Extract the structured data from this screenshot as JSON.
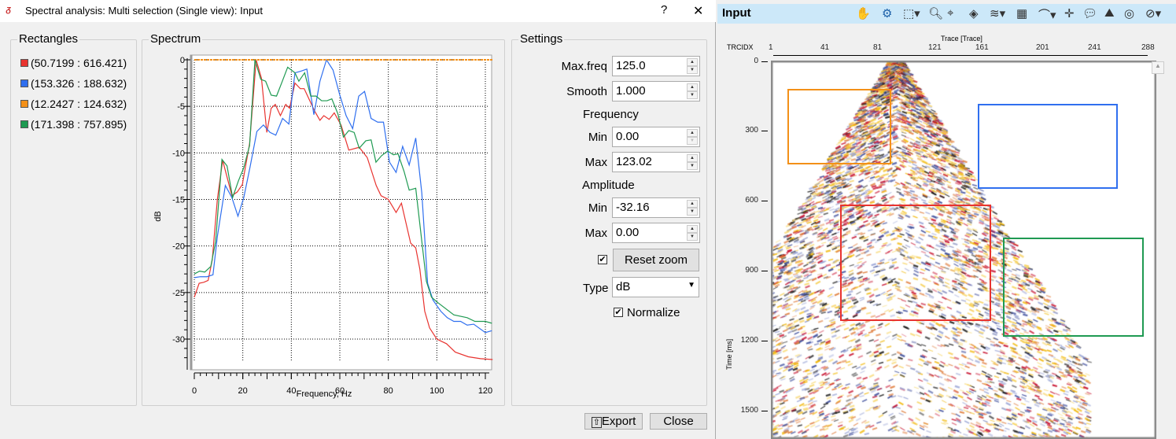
{
  "dialog": {
    "title": "Spectral analysis: Multi selection (Single view): Input",
    "help": "?",
    "close": "✕",
    "export_label": "Export",
    "close_label": "Close"
  },
  "rectangles": {
    "label": "Rectangles",
    "items": [
      {
        "text": "(50.7199 : 616.421)",
        "color": "#e8332f"
      },
      {
        "text": "(153.326 : 188.632)",
        "color": "#2f6fef"
      },
      {
        "text": "(12.2427 : 124.632)",
        "color": "#f39018"
      },
      {
        "text": "(171.398 : 757.895)",
        "color": "#1f9a52"
      }
    ]
  },
  "spectrum": {
    "label": "Spectrum"
  },
  "settings": {
    "label": "Settings",
    "max_freq_label": "Max.freq",
    "max_freq": "125.0",
    "smooth_label": "Smooth",
    "smooth": "1.000",
    "frequency_label": "Frequency",
    "freq_min_label": "Min",
    "freq_min": "0.00",
    "freq_max_label": "Max",
    "freq_max": "123.02",
    "amplitude_label": "Amplitude",
    "amp_min_label": "Min",
    "amp_min": "-32.16",
    "amp_max_label": "Max",
    "amp_max": "0.00",
    "reset_zoom_label": "Reset zoom",
    "reset_zoom_checked": true,
    "type_label": "Type",
    "type": "dB",
    "normalize_label": "Normalize",
    "normalize_checked": true
  },
  "chart_data": {
    "type": "line",
    "xlabel": "Frequency, Hz",
    "ylabel": "dB",
    "xlim": [
      0,
      123.02
    ],
    "ylim": [
      -32.16,
      0
    ],
    "xticks": [
      0,
      20,
      40,
      60,
      80,
      100,
      120
    ],
    "yticks": [
      0,
      -5,
      -10,
      -15,
      -20,
      -25,
      -30
    ],
    "grid": true,
    "series": [
      {
        "name": "(50.7199 : 616.421)",
        "color": "#e8332f",
        "points": [
          [
            0,
            -25.5
          ],
          [
            2,
            -24
          ],
          [
            3.9,
            -23.9
          ],
          [
            5.7,
            -23.7
          ],
          [
            7.4,
            -21.5
          ],
          [
            9.5,
            -15
          ],
          [
            11.7,
            -10.8
          ],
          [
            13.9,
            -13
          ],
          [
            15.5,
            -14.6
          ],
          [
            17.7,
            -14.2
          ],
          [
            19.8,
            -13.4
          ],
          [
            22.8,
            -9
          ],
          [
            25.5,
            0
          ],
          [
            27.7,
            -2
          ],
          [
            29.9,
            -7.8
          ],
          [
            31.7,
            -5.2
          ],
          [
            33.4,
            -4.8
          ],
          [
            35.5,
            -6
          ],
          [
            37.7,
            -4.8
          ],
          [
            39.3,
            -5.2
          ],
          [
            41.5,
            -2.5
          ],
          [
            43.7,
            -3.1
          ],
          [
            45.3,
            -3.1
          ],
          [
            49.6,
            -5.5
          ],
          [
            51.8,
            -6.5
          ],
          [
            53.4,
            -6
          ],
          [
            55.6,
            -6.4
          ],
          [
            57.7,
            -5.7
          ],
          [
            60.5,
            -7
          ],
          [
            63.7,
            -9.7
          ],
          [
            68,
            -9.4
          ],
          [
            71.3,
            -10.5
          ],
          [
            75,
            -13.5
          ],
          [
            77,
            -14.6
          ],
          [
            80,
            -15
          ],
          [
            83.2,
            -16.4
          ],
          [
            85.4,
            -15.4
          ],
          [
            89.2,
            -19.7
          ],
          [
            91.3,
            -20.2
          ],
          [
            93,
            -22.5
          ],
          [
            95,
            -27
          ],
          [
            97,
            -28.8
          ],
          [
            100,
            -30
          ],
          [
            104,
            -30.5
          ],
          [
            107.6,
            -31.4
          ],
          [
            113,
            -31.9
          ],
          [
            118,
            -32.1
          ],
          [
            123,
            -32.2
          ]
        ]
      },
      {
        "name": "(153.326 : 188.632)",
        "color": "#2f6fef",
        "points": [
          [
            0,
            -23.4
          ],
          [
            2.5,
            -23.3
          ],
          [
            5.2,
            -23.3
          ],
          [
            7.7,
            -23.1
          ],
          [
            9.5,
            -19
          ],
          [
            12.8,
            -13.5
          ],
          [
            15.5,
            -14.8
          ],
          [
            18,
            -16.8
          ],
          [
            20.4,
            -14.8
          ],
          [
            23,
            -11.5
          ],
          [
            25.8,
            -7.7
          ],
          [
            28.5,
            -7
          ],
          [
            31.2,
            -7.8
          ],
          [
            33.6,
            -8.1
          ],
          [
            36.4,
            -6.3
          ],
          [
            39,
            -6.9
          ],
          [
            41.5,
            -1.4
          ],
          [
            44.2,
            -1.2
          ],
          [
            46.4,
            -1
          ],
          [
            49.3,
            -5.9
          ],
          [
            51.8,
            -2.3
          ],
          [
            54.5,
            0
          ],
          [
            57.2,
            -1.1
          ],
          [
            59.9,
            -3.7
          ],
          [
            62.6,
            -6
          ],
          [
            65.3,
            -7.4
          ],
          [
            67.8,
            -3.9
          ],
          [
            70.2,
            -3.4
          ],
          [
            72.9,
            -6.3
          ],
          [
            75.6,
            -6.7
          ],
          [
            78,
            -6.7
          ],
          [
            80.5,
            -11
          ],
          [
            83.2,
            -12.1
          ],
          [
            85.9,
            -9.3
          ],
          [
            88.6,
            -11.3
          ],
          [
            91.3,
            -8.4
          ],
          [
            93.8,
            -14.3
          ],
          [
            96.2,
            -24
          ],
          [
            98.4,
            -25.8
          ],
          [
            101.6,
            -27
          ],
          [
            104.3,
            -27.7
          ],
          [
            107,
            -28.1
          ],
          [
            109.8,
            -28.1
          ],
          [
            112.5,
            -28.5
          ],
          [
            115.2,
            -28.4
          ],
          [
            120,
            -29.3
          ],
          [
            122.7,
            -29.1
          ]
        ]
      },
      {
        "name": "(12.2427 : 124.632)",
        "color": "#f39018",
        "points": [
          [
            0,
            0
          ],
          [
            20,
            0
          ],
          [
            40,
            0
          ],
          [
            60,
            0
          ],
          [
            80,
            0
          ],
          [
            100,
            0
          ],
          [
            123,
            0
          ]
        ]
      },
      {
        "name": "(171.398 : 757.895)",
        "color": "#1f9a52",
        "points": [
          [
            0,
            -23
          ],
          [
            2.2,
            -22.7
          ],
          [
            4.3,
            -22.8
          ],
          [
            6.8,
            -22.2
          ],
          [
            8.8,
            -19.5
          ],
          [
            11.4,
            -10.7
          ],
          [
            13.5,
            -11.4
          ],
          [
            15.8,
            -14.8
          ],
          [
            18.2,
            -13
          ],
          [
            20.4,
            -11.6
          ],
          [
            22.8,
            -9.2
          ],
          [
            25,
            0
          ],
          [
            27.4,
            -2.1
          ],
          [
            29.4,
            -2.3
          ],
          [
            31.7,
            -3.8
          ],
          [
            33.9,
            -3.9
          ],
          [
            36,
            -2.5
          ],
          [
            38.5,
            -0.8
          ],
          [
            41.5,
            -1.4
          ],
          [
            43.1,
            -2.3
          ],
          [
            45.5,
            -1.4
          ],
          [
            48,
            -3.9
          ],
          [
            50.2,
            -3.9
          ],
          [
            52.5,
            -4.4
          ],
          [
            54.7,
            -4.4
          ],
          [
            56.7,
            -4.2
          ],
          [
            59.2,
            -5.8
          ],
          [
            61.5,
            -8.3
          ],
          [
            63.7,
            -7.6
          ],
          [
            65.9,
            -7.8
          ],
          [
            68,
            -9.5
          ],
          [
            70.7,
            -8.7
          ],
          [
            72.9,
            -8.6
          ],
          [
            74.9,
            -11
          ],
          [
            77.2,
            -10.3
          ],
          [
            79.7,
            -9.8
          ],
          [
            82.1,
            -10.2
          ],
          [
            84,
            -10.1
          ],
          [
            86.5,
            -12
          ],
          [
            88.6,
            -14
          ],
          [
            91.3,
            -13.8
          ],
          [
            95.7,
            -23.8
          ],
          [
            97.8,
            -25.5
          ],
          [
            100,
            -26
          ],
          [
            107,
            -27.4
          ],
          [
            112.5,
            -27.7
          ],
          [
            115.7,
            -28.1
          ],
          [
            120,
            -28.1
          ],
          [
            122.7,
            -28.3
          ]
        ]
      }
    ]
  },
  "viewer": {
    "title": "Input",
    "x_axis_title": "Trace [Trace]",
    "x_axis_key": "TRCIDX",
    "x_ticks": [
      "1",
      "41",
      "81",
      "121",
      "161",
      "201",
      "241",
      "288"
    ],
    "y_axis_title": "Time [ms]",
    "y_ticks": [
      "0",
      "300",
      "600",
      "900",
      "1200",
      "1500"
    ],
    "toolbar_icons": [
      "pan-icon",
      "settings-icon",
      "zoom-rect-icon",
      "zoom-icon",
      "pointer-icon",
      "layers-icon",
      "wiggle-icon",
      "header-table-icon",
      "spectrum-icon",
      "crosshair-icon",
      "comment-icon",
      "export-image-icon",
      "measure-icon",
      "compass-icon"
    ]
  }
}
